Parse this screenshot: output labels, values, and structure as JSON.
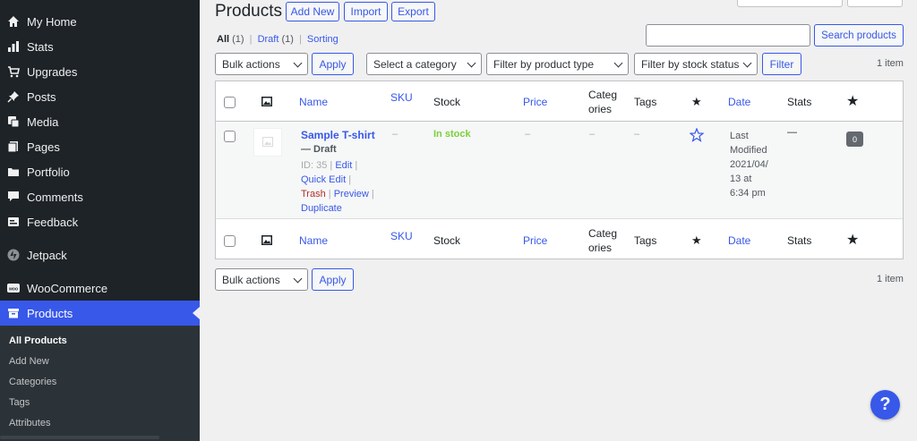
{
  "sidebar": {
    "items": [
      {
        "label": "My Home",
        "icon": "home-icon"
      },
      {
        "label": "Stats",
        "icon": "stats-icon"
      },
      {
        "label": "Upgrades",
        "icon": "cart-icon"
      },
      {
        "label": "Posts",
        "icon": "pin-icon"
      },
      {
        "label": "Media",
        "icon": "media-icon"
      },
      {
        "label": "Pages",
        "icon": "pages-icon"
      },
      {
        "label": "Portfolio",
        "icon": "folder-icon"
      },
      {
        "label": "Comments",
        "icon": "comment-icon"
      },
      {
        "label": "Feedback",
        "icon": "feedback-icon"
      },
      {
        "label": "Jetpack",
        "icon": "jetpack-icon"
      },
      {
        "label": "WooCommerce",
        "icon": "woo-icon"
      },
      {
        "label": "Products",
        "icon": "archive-icon"
      }
    ],
    "submenu": [
      "All Products",
      "Add New",
      "Categories",
      "Tags",
      "Attributes"
    ]
  },
  "header": {
    "title": "Products",
    "add_new": "Add New",
    "import": "Import",
    "export": "Export"
  },
  "views": {
    "all": "All",
    "all_count": "(1)",
    "draft": "Draft",
    "draft_count": "(1)",
    "sorting": "Sorting",
    "sep": "|"
  },
  "search": {
    "button": "Search products",
    "value": ""
  },
  "filters": {
    "bulk_actions": "Bulk actions",
    "apply": "Apply",
    "category": "Select a category",
    "product_type": "Filter by product type",
    "stock_status": "Filter by stock status",
    "filter": "Filter",
    "item_count": "1 item"
  },
  "columns": {
    "name": "Name",
    "sku": "SKU",
    "stock": "Stock",
    "price": "Price",
    "categories_1": "Categ",
    "categories_2": "ories",
    "tags": "Tags",
    "date": "Date",
    "stats": "Stats"
  },
  "product": {
    "title": "Sample T-shirt",
    "state": "— Draft",
    "id": "ID: 35",
    "edit": "Edit",
    "quick_edit": "Quick Edit",
    "trash": "Trash",
    "preview": "Preview",
    "duplicate": "Duplicate",
    "sep": "|",
    "sku": "–",
    "stock": "In stock",
    "price": "–",
    "categories": "–",
    "tags": "–",
    "date_1": "Last",
    "date_2": "Modified",
    "date_3": "2021/04/",
    "date_4": "13 at",
    "date_5": "6:34 pm",
    "stats": "—",
    "badge": "0"
  },
  "help": {
    "label": "?"
  },
  "colors": {
    "accent": "#3858e9",
    "sidebar": "#1d2327",
    "instock": "#7ad03a"
  }
}
